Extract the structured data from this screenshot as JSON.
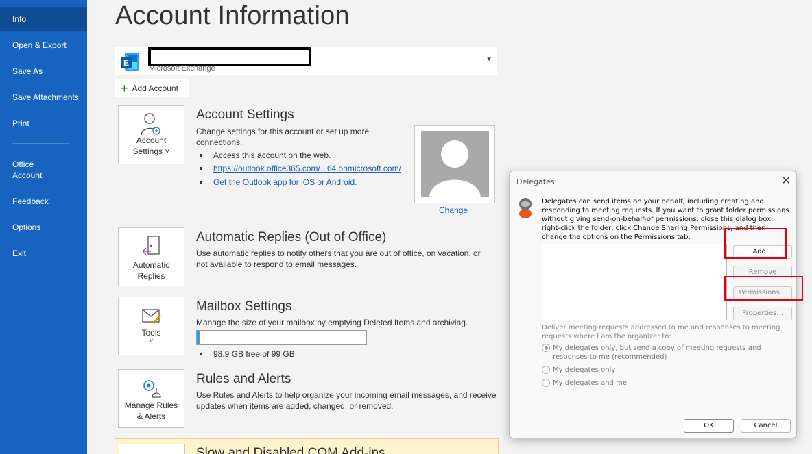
{
  "nav": {
    "items": [
      {
        "label": "Info",
        "active": true
      },
      {
        "label": "Open & Export"
      },
      {
        "label": "Save As"
      },
      {
        "label": "Save Attachments"
      },
      {
        "label": "Print"
      },
      {
        "label": "Office\nAccount"
      },
      {
        "label": "Feedback"
      },
      {
        "label": "Options"
      },
      {
        "label": "Exit"
      }
    ]
  },
  "page": {
    "title": "Account Information"
  },
  "account": {
    "type": "Microsoft Exchange",
    "add_label": "Add Account"
  },
  "sections": {
    "account_settings": {
      "tile_label": "Account\nSettings ˅",
      "title": "Account Settings",
      "desc": "Change settings for this account or set up more connections.",
      "bullet1": "Access this account on the web.",
      "link1": "https://outlook.office365.com/...64.onmicrosoft.com/",
      "link2": "Get the Outlook app for iOS or Android.",
      "change": "Change"
    },
    "auto_replies": {
      "tile_label": "Automatic\nReplies",
      "title": "Automatic Replies (Out of Office)",
      "desc": "Use automatic replies to notify others that you are out of office, on vacation, or not available to respond to email messages."
    },
    "mailbox": {
      "tile_label": "Tools",
      "tile_caret": "˅",
      "title": "Mailbox Settings",
      "desc": "Manage the size of your mailbox by emptying Deleted Items and archiving.",
      "storage_used_fraction": 0.02,
      "storage_text": "98.9 GB free of 99 GB"
    },
    "rules": {
      "tile_label": "Manage Rules\n& Alerts",
      "title": "Rules and Alerts",
      "desc": "Use Rules and Alerts to help organize your incoming email messages, and receive updates when items are added, changed, or removed."
    },
    "com": {
      "title": "Slow and Disabled COM Add-ins"
    }
  },
  "dialog": {
    "title": "Delegates",
    "close": "✕",
    "info": "Delegates can send items on your behalf, including creating and responding to meeting requests. If you want to grant folder permissions without giving send-on-behalf-of permissions, close this dialog box, right-click the folder, click Change Sharing Permissions, and then change the options on the Permissions tab.",
    "buttons": {
      "add": "Add...",
      "remove": "Remove",
      "permissions": "Permissions...",
      "properties": "Properties..."
    },
    "deliver_label": "Deliver meeting requests addressed to me and responses to meeting requests where I am the organizer to:",
    "options": [
      {
        "label": "My delegates only, but send a copy of meeting requests and responses to me (recommended)",
        "checked": true
      },
      {
        "label": "My delegates only",
        "checked": false
      },
      {
        "label": "My delegates and me",
        "checked": false
      }
    ],
    "ok": "OK",
    "cancel": "Cancel"
  },
  "colors": {
    "nav_bg": "#1764c0",
    "nav_active": "#0f4c95",
    "link": "#1a5fb4",
    "highlight": "#e3000f"
  }
}
